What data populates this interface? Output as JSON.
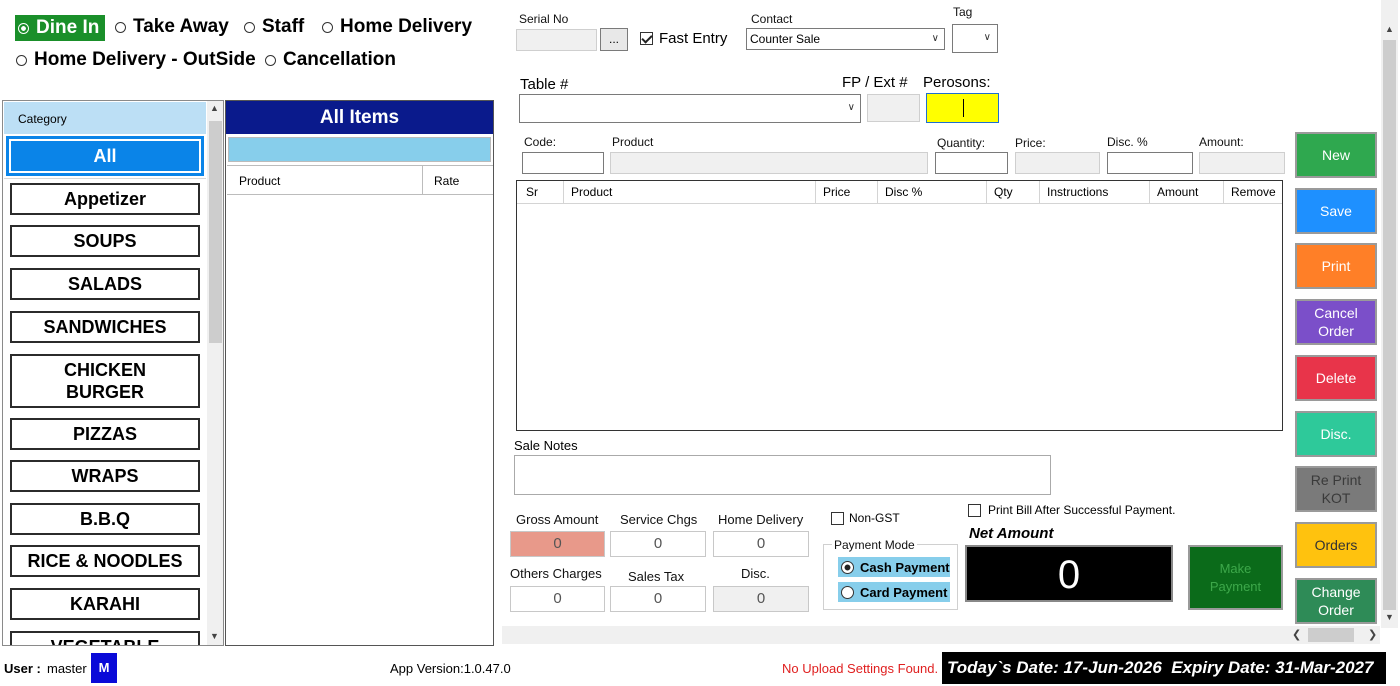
{
  "order_types": [
    {
      "label": "Dine In",
      "selected": true
    },
    {
      "label": "Take Away",
      "selected": false
    },
    {
      "label": "Staff",
      "selected": false
    },
    {
      "label": "Home Delivery",
      "selected": false
    },
    {
      "label": "Home Delivery - OutSide",
      "selected": false
    },
    {
      "label": "Cancellation",
      "selected": false
    }
  ],
  "header": {
    "serial_label": "Serial No",
    "serial_value": "",
    "serial_browse": "...",
    "fast_entry_label": "Fast Entry",
    "fast_entry_checked": true,
    "contact_label": "Contact",
    "contact_value": "Counter Sale",
    "tag_label": "Tag",
    "tag_value": "",
    "table_label": "Table #",
    "table_value": "",
    "fp_label": "FP / Ext #",
    "fp_value": "",
    "persons_label": "Perosons:",
    "persons_value": ""
  },
  "category_panel": {
    "header": "Category",
    "items": [
      "All",
      "Appetizer",
      "SOUPS",
      "SALADS",
      "SANDWICHES",
      "CHICKEN BURGER",
      "PIZZAS",
      "WRAPS",
      "B.B.Q",
      "RICE & NOODLES",
      "KARAHI",
      "VEGETABLE"
    ],
    "selected": "All"
  },
  "items_panel": {
    "title": "All Items",
    "search_value": "",
    "columns": [
      "Product",
      "Rate"
    ]
  },
  "entry": {
    "code_label": "Code:",
    "product_label": "Product",
    "quantity_label": "Quantity:",
    "price_label": "Price:",
    "disc_label": "Disc. %",
    "amount_label": "Amount:"
  },
  "order_grid": {
    "columns": [
      "Sr",
      "Product",
      "Price",
      "Disc %",
      "Qty",
      "Instructions",
      "Amount",
      "Remove"
    ],
    "rows": []
  },
  "sale_notes_label": "Sale Notes",
  "totals": {
    "gross_label": "Gross Amount",
    "gross_value": "0",
    "service_label": "Service Chgs",
    "service_value": "0",
    "home_delivery_label": "Home Delivery",
    "home_delivery_value": "0",
    "others_label": "Others Charges",
    "others_value": "0",
    "sales_tax_label": "Sales Tax",
    "sales_tax_value": "0",
    "disc_label": "Disc.",
    "disc_value": "0"
  },
  "non_gst_label": "Non-GST",
  "payment": {
    "legend": "Payment Mode",
    "options": [
      "Cash Payment",
      "Card Payment"
    ],
    "selected": "Cash Payment"
  },
  "print_bill_label": "Print Bill After Successful Payment.",
  "net_amount_label": "Net Amount",
  "net_amount_value": "0",
  "make_payment_label": "Make Payment",
  "side_buttons": [
    {
      "label": "New",
      "color": "#2fa84f"
    },
    {
      "label": "Save",
      "color": "#1e90ff"
    },
    {
      "label": "Print",
      "color": "#ff7f27"
    },
    {
      "label": "Cancel Order",
      "color": "#7b4fc9"
    },
    {
      "label": "Delete",
      "color": "#e8344a"
    },
    {
      "label": "Disc.",
      "color": "#2ec99a"
    },
    {
      "label": "Re Print KOT",
      "color": "#7a7a7a"
    },
    {
      "label": "Orders",
      "color": "#ffc20e"
    },
    {
      "label": "Change Order",
      "color": "#2e8b57"
    }
  ],
  "status_bar": {
    "user_label": "User :",
    "user_value": "master",
    "user_badge": "M",
    "app_version": "App Version:1.0.47.0",
    "upload_warning": "No Upload Settings Found.",
    "dates": "Today`s Date: 17-Jun-2026  Expiry Date: 31-Mar-2027"
  },
  "colors": {
    "accent_green": "#1a8f2a",
    "category_header": "#bcdff5",
    "selected_category": "#0a84e8",
    "items_title_bg": "#0a1a8c",
    "persons_bg": "#ffff00",
    "gross_bg": "#e8998a",
    "payment_option_bg": "#87ceeb",
    "make_payment_bg": "#0b6b1a",
    "status_dark": "#000000",
    "warning_red": "#e02020"
  }
}
